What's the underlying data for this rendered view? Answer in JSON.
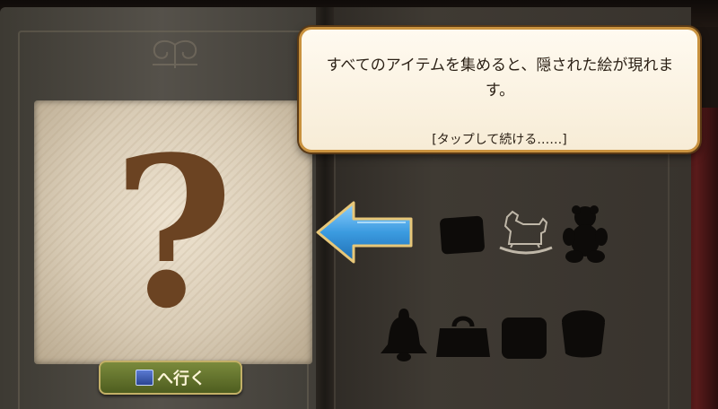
{
  "dialog": {
    "message": "すべてのアイテムを集めると、隠された絵が現れます。",
    "continue_hint": "[タップして続ける……]"
  },
  "picture": {
    "placeholder": "?"
  },
  "go_button": {
    "label": "へ行く"
  },
  "silhouettes": [
    "block-icon",
    "rocking-horse-icon",
    "teddy-bear-icon",
    "bell-icon",
    "handbag-icon",
    "drum-icon",
    "basket-icon"
  ],
  "colors": {
    "dialog_border": "#c9923f",
    "arrow": "#3b9be0",
    "question_mark": "#6b4322",
    "button": "#5e6d27"
  }
}
